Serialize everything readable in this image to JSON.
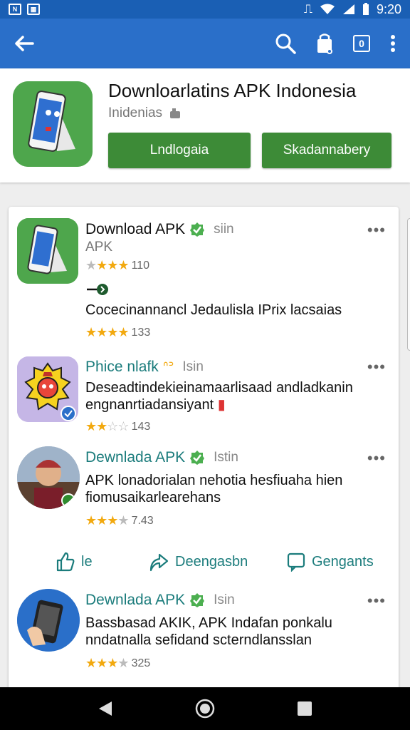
{
  "status_bar": {
    "time": "9:20"
  },
  "app_bar": {
    "counter": "0"
  },
  "header": {
    "title": "Downloarlatins APK Indonesia",
    "subtitle": "Inidenias",
    "button_primary": "Lndlogaia",
    "button_secondary": "Skadannabery"
  },
  "items": [
    {
      "title": "Download  APK",
      "tag": "siin",
      "line1": "APK",
      "rating1": "110",
      "line2": "Cocecinannancl Jedaulisla  IPrix lacsaias",
      "rating2": "133"
    },
    {
      "title": "Phice nlafk",
      "tag": "Isin",
      "desc": "Deseadtindekieinamaarlisaad andladkanin engnanrtiadansiyant",
      "rating": "143"
    },
    {
      "title": "Dewnlada  APK",
      "tag": "Istin",
      "desc": "APK lonadorialan nehotia hesfiuaha hien fiomusaikarlearehans",
      "rating": "7.43"
    },
    {
      "title": "Dewnlada  APK",
      "tag": "Isin",
      "desc": "Bassbasad AKIK, APK Indafan ponkalu nndatnalla sefidand scterndlansslan",
      "rating": "325"
    }
  ],
  "actions": {
    "like": "le",
    "share": "Deengasbn",
    "comment": "Gengants"
  },
  "colors": {
    "app_bar": "#2a6fc9",
    "accent_green": "#3d8b37",
    "teal_text": "#1b7c7c",
    "star": "#f2a90f"
  }
}
